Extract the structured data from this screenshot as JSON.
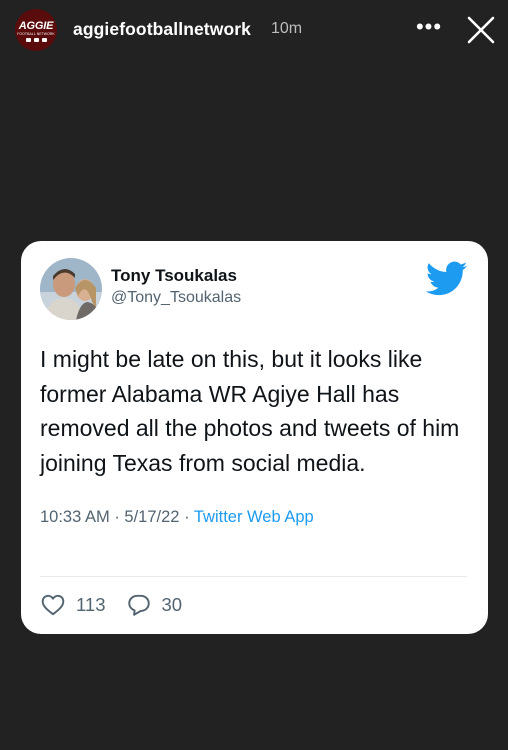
{
  "story": {
    "logo_text": "AGGIE",
    "logo_subtext": "FOOTBALL NETWORK",
    "account_name": "aggiefootballnetwork",
    "time_ago": "10m",
    "more_label": "•••"
  },
  "tweet": {
    "display_name": "Tony Tsoukalas",
    "handle": "@Tony_Tsoukalas",
    "text": "I might be late on this, but it looks like former Alabama WR Agiye Hall has removed all the photos and tweets of him joining Texas from social media.",
    "time": "10:33 AM",
    "separator": "·",
    "date": "5/17/22",
    "source": "Twitter Web App",
    "likes": "113",
    "replies": "30"
  },
  "colors": {
    "background": "#222222",
    "card": "#ffffff",
    "twitter_blue": "#1d9bf0",
    "secondary_text": "#536471"
  },
  "icons": [
    "aggie-logo-icon",
    "more-options-icon",
    "close-icon",
    "twitter-bird-icon",
    "heart-icon",
    "reply-bubble-icon"
  ]
}
